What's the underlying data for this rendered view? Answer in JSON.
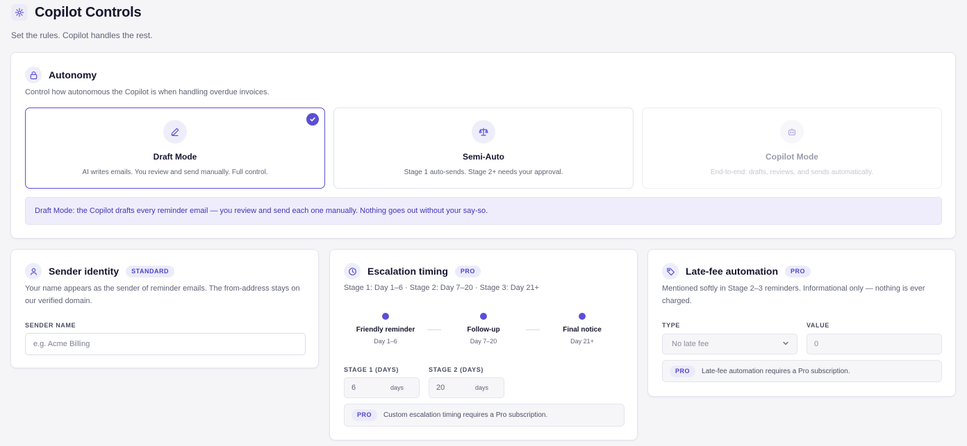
{
  "header": {
    "title": "Copilot Controls",
    "subtitle": "Set the rules. Copilot handles the rest.",
    "icon": "sparkle-icon"
  },
  "autonomy": {
    "title": "Autonomy",
    "description": "Control how autonomous the Copilot is when handling overdue invoices.",
    "modes": [
      {
        "name": "Draft Mode",
        "description": "AI writes emails. You review and send manually. Full control.",
        "icon": "pencil-icon",
        "selected": true,
        "disabled": false
      },
      {
        "name": "Semi-Auto",
        "description": "Stage 1 auto-sends. Stage 2+ needs your approval.",
        "icon": "scale-icon",
        "selected": false,
        "disabled": false
      },
      {
        "name": "Copilot Mode",
        "description": "End-to-end: drafts, reviews, and sends automatically.",
        "icon": "robot-icon",
        "selected": false,
        "disabled": true
      }
    ],
    "banner": "Draft Mode: the Copilot drafts every reminder email — you review and send each one manually. Nothing goes out without your say-so."
  },
  "sender": {
    "title": "Sender identity",
    "badge": "STANDARD",
    "description": "Your name appears as the sender of reminder emails. The from-address stays on our verified domain.",
    "field_label": "SENDER NAME",
    "placeholder": "e.g. Acme Billing",
    "value": ""
  },
  "escalation": {
    "title": "Escalation timing",
    "badge": "PRO",
    "summary": "Stage 1: Day 1–6 · Stage 2: Day 7–20 · Stage 3: Day 21+",
    "stages": [
      {
        "name": "Friendly reminder",
        "range": "Day 1–6"
      },
      {
        "name": "Follow-up",
        "range": "Day 7–20"
      },
      {
        "name": "Final notice",
        "range": "Day 21+"
      }
    ],
    "stage1_label": "STAGE 1 (DAYS)",
    "stage1_value": "6",
    "stage2_label": "STAGE 2 (DAYS)",
    "stage2_value": "20",
    "unit": "days",
    "pro_badge": "PRO",
    "pro_note": "Custom escalation timing requires a Pro subscription."
  },
  "latefee": {
    "title": "Late-fee automation",
    "badge": "PRO",
    "description": "Mentioned softly in Stage 2–3 reminders. Informational only — nothing is ever charged.",
    "type_label": "TYPE",
    "type_value": "No late fee",
    "value_label": "VALUE",
    "value_value": "0",
    "pro_badge": "PRO",
    "pro_note": "Late-fee automation requires a Pro subscription."
  },
  "colors": {
    "accent": "#5b4fd6",
    "banner_bg": "#efedfc",
    "page_bg": "#f5f5f8"
  }
}
